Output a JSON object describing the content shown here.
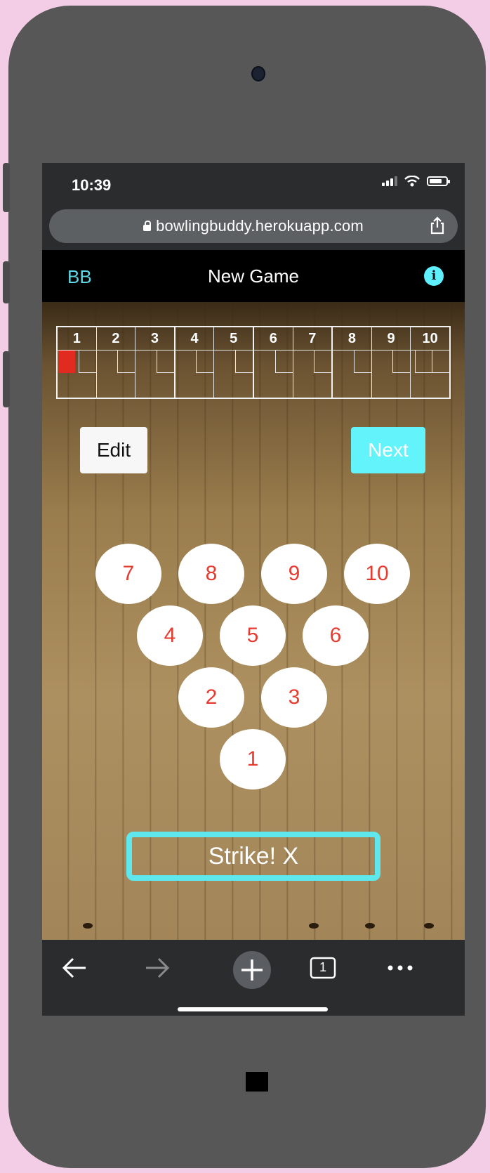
{
  "status_bar": {
    "time": "10:39"
  },
  "browser": {
    "url": "bowlingbuddy.herokuapp.com"
  },
  "navbar": {
    "brand": "BB",
    "title": "New Game"
  },
  "scoreboard": {
    "frames": [
      "1",
      "2",
      "3",
      "4",
      "5",
      "6",
      "7",
      "8",
      "9",
      "10"
    ],
    "current_frame": 1
  },
  "buttons": {
    "edit": "Edit",
    "next": "Next"
  },
  "pins": [
    "1",
    "2",
    "3",
    "4",
    "5",
    "6",
    "7",
    "8",
    "9",
    "10"
  ],
  "result": "Strike! X",
  "tabs": {
    "count": "1"
  },
  "colors": {
    "accent": "#5ef0ff",
    "pin_text": "#e63b2e",
    "current_marker": "#e22b20"
  }
}
